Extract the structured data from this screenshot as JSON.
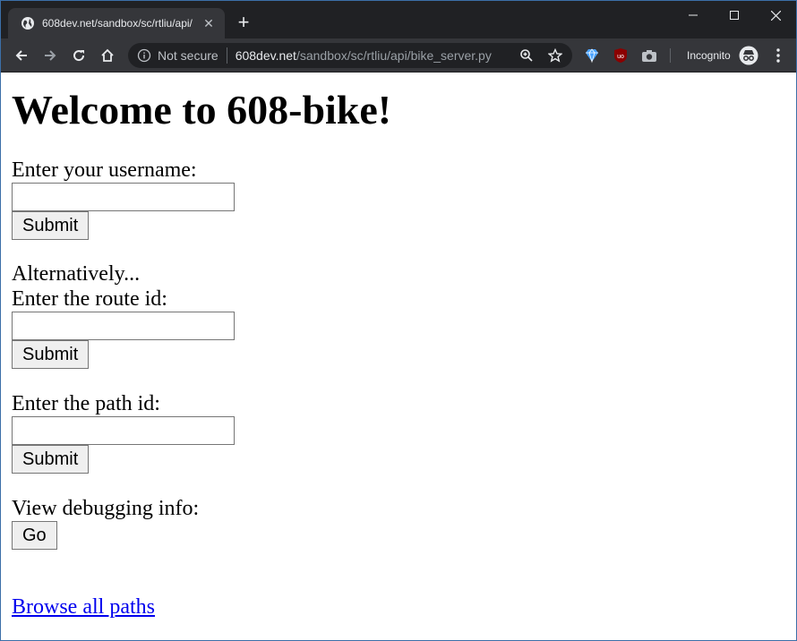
{
  "browser": {
    "tab_title": "608dev.net/sandbox/sc/rtliu/api/",
    "new_tab_symbol": "+",
    "security_text": "Not secure",
    "url_host": "608dev.net",
    "url_path": "/sandbox/sc/rtliu/api/bike_server.py",
    "incognito_label": "Incognito",
    "colors": {
      "frame": "#202124",
      "toolbar": "#35363a",
      "omnibox": "#202124"
    },
    "icons": [
      "globe-icon",
      "close-icon",
      "minimize-icon",
      "maximize-icon",
      "back-icon",
      "forward-icon",
      "reload-icon",
      "home-icon",
      "info-icon",
      "zoom-icon",
      "star-icon",
      "extension-diamond-icon",
      "ublock-icon",
      "camera-icon",
      "incognito-icon",
      "menu-icon"
    ]
  },
  "page": {
    "heading": "Welcome to 608-bike!",
    "username_label": "Enter your username:",
    "username_value": "",
    "submit_label": "Submit",
    "alternatively": "Alternatively...",
    "route_label": "Enter the route id:",
    "route_value": "",
    "path_label": "Enter the path id:",
    "path_value": "",
    "debug_label": "View debugging info:",
    "go_label": "Go",
    "browse_link": "Browse all paths",
    "link_color": "#0000ee"
  }
}
